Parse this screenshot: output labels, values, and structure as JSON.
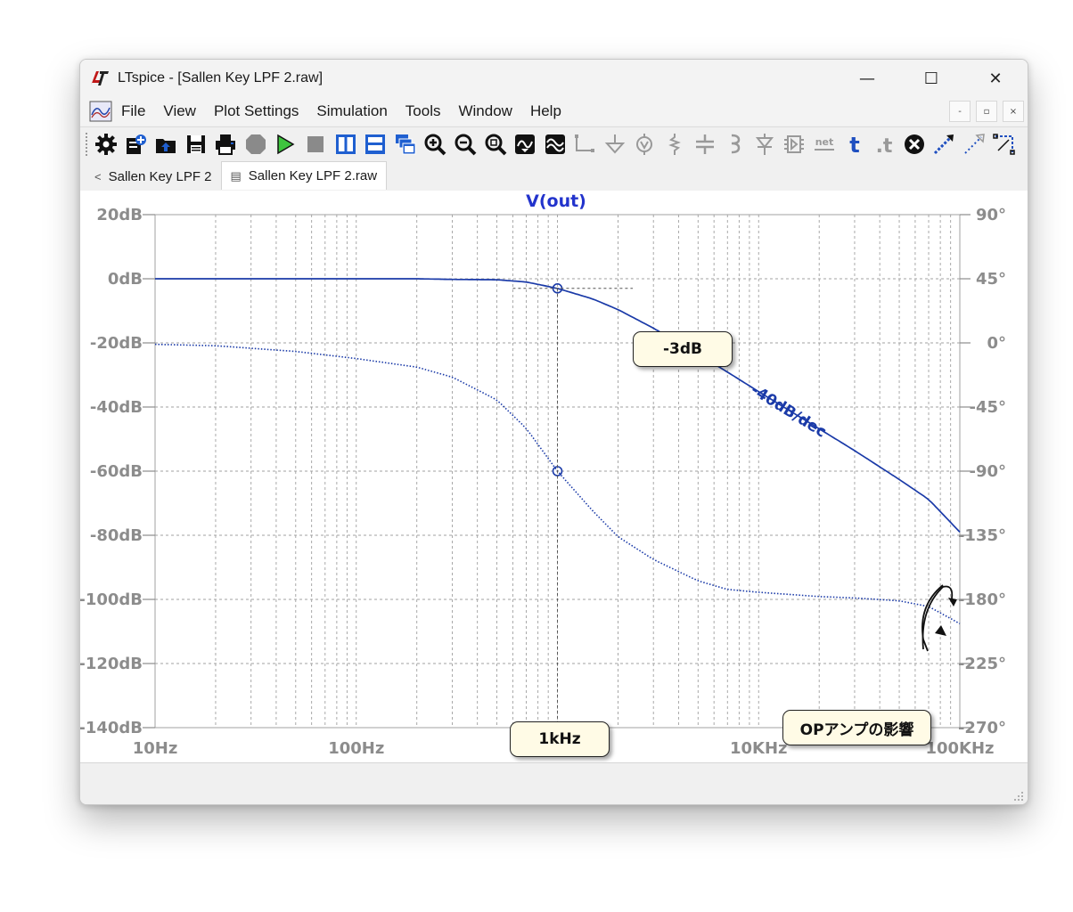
{
  "window": {
    "title": "LTspice - [Sallen Key LPF 2.raw]",
    "controls": {
      "minimize": "—",
      "maximize": "☐",
      "close": "✕"
    },
    "mdi_controls": [
      "-",
      "▫",
      "×"
    ]
  },
  "menu": [
    "File",
    "View",
    "Plot Settings",
    "Simulation",
    "Tools",
    "Window",
    "Help"
  ],
  "toolbar": [
    "settings-icon",
    "new-schematic-icon",
    "open-icon",
    "save-icon",
    "print-icon",
    "halt-icon",
    "run-icon",
    "stop-icon",
    "tile-vertical-icon",
    "tile-horizontal-icon",
    "cascade-icon",
    "zoom-in-icon",
    "zoom-out-icon",
    "zoom-fit-icon",
    "autorange-icon",
    "waveform-icon",
    "wire-icon",
    "ground-icon",
    "voltage-source-icon",
    "resistor-icon",
    "capacitor-icon",
    "inductor-icon",
    "diode-icon",
    "component-icon",
    "net-label-icon",
    "spice-directive-icon",
    "text-icon",
    "delete-icon",
    "move-icon",
    "drag-icon",
    "mirror-icon"
  ],
  "toolbar_text": {
    "net": "net",
    "t1": "t",
    "t2": ".t"
  },
  "tabs": [
    {
      "label": "Sallen Key LPF 2",
      "icon": "<"
    },
    {
      "label": "Sallen Key LPF 2.raw",
      "icon": "▤"
    }
  ],
  "colors": {
    "trace": "#1a3aa8",
    "grid": "#a0a0a0",
    "axis_text": "#8c8c8c",
    "title": "#2233cc"
  },
  "chart_data": {
    "type": "line",
    "title": "V(out)",
    "x_scale": "log",
    "x_ticks": [
      "10Hz",
      "100Hz",
      "1KHz",
      "10KHz",
      "100KHz"
    ],
    "x_range": [
      10,
      100000
    ],
    "y_left_ticks": [
      "20dB",
      "0dB",
      "-20dB",
      "-40dB",
      "-60dB",
      "-80dB",
      "-100dB",
      "-120dB",
      "-140dB"
    ],
    "y_left_range": [
      -140,
      20
    ],
    "y_right_ticks": [
      "90°",
      "45°",
      "0°",
      "-45°",
      "-90°",
      "-135°",
      "-180°",
      "-225°",
      "-270°"
    ],
    "y_right_range": [
      -270,
      90
    ],
    "grid": true,
    "series": [
      {
        "name": "V(out)",
        "axis": "left",
        "style": "solid",
        "x": [
          10,
          100,
          200,
          300,
          500,
          700,
          1000,
          1500,
          2000,
          3000,
          5000,
          7000,
          10000,
          20000,
          30000,
          50000,
          70000,
          100000
        ],
        "y": [
          0,
          0,
          0,
          -0.2,
          -0.3,
          -1.0,
          -3.0,
          -6.3,
          -9.6,
          -15.4,
          -23.5,
          -29.1,
          -35.2,
          -46.8,
          -53.6,
          -62.6,
          -68.8,
          -79
        ]
      },
      {
        "name": "phase",
        "axis": "right",
        "style": "dotted",
        "x": [
          10,
          20,
          50,
          100,
          200,
          300,
          500,
          700,
          1000,
          1500,
          2000,
          3000,
          5000,
          7000,
          10000,
          20000,
          30000,
          50000,
          70000,
          100000
        ],
        "y": [
          -1,
          -2,
          -6,
          -11,
          -17,
          -24,
          -40,
          -60,
          -90,
          -118,
          -136,
          -152,
          -167,
          -173,
          -175,
          -178,
          -179,
          -181,
          -185,
          -197
        ]
      }
    ],
    "markers": [
      {
        "series": "V(out)",
        "x": 1000,
        "y": -3
      },
      {
        "series": "phase",
        "x": 1000,
        "y": -90
      }
    ],
    "annotations": {
      "minus3db": "-3dB",
      "f1k": "1kHz",
      "slope": "-40dB/dec",
      "opamp": "OPアンプの影響"
    }
  }
}
